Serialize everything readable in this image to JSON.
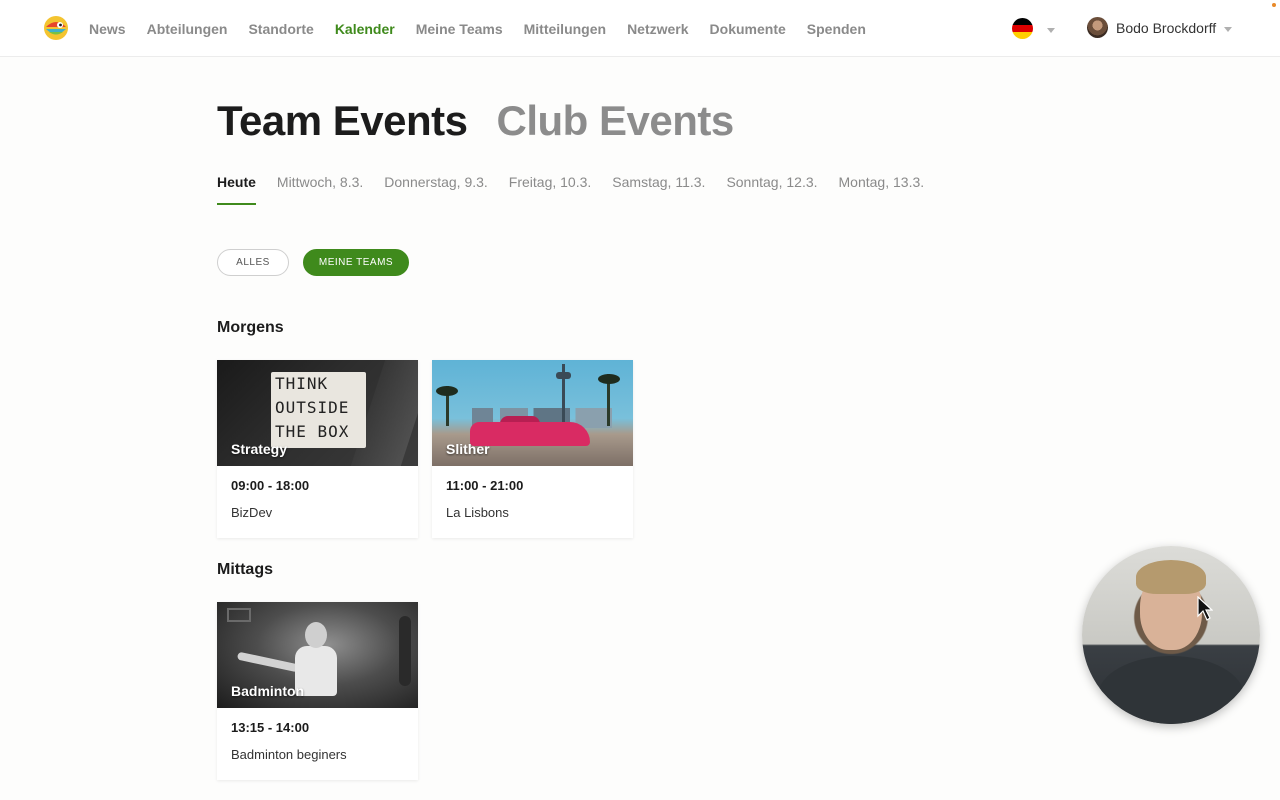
{
  "nav": {
    "items": [
      "News",
      "Abteilungen",
      "Standorte",
      "Kalender",
      "Meine Teams",
      "Mitteilungen",
      "Netzwerk",
      "Dokumente",
      "Spenden"
    ],
    "active": "Kalender"
  },
  "user": {
    "name": "Bodo Brockdorff"
  },
  "language": {
    "flag_colors": [
      "#000000",
      "#dd0000",
      "#ffce00"
    ]
  },
  "headings": {
    "team_events": "Team Events",
    "club_events": "Club Events"
  },
  "days": [
    "Heute",
    "Mittwoch, 8.3.",
    "Donnerstag, 9.3.",
    "Freitag, 10.3.",
    "Samstag, 11.3.",
    "Sonntag, 12.3.",
    "Montag, 13.3."
  ],
  "filters": {
    "all": "ALLES",
    "my_teams": "MEINE TEAMS"
  },
  "sections": {
    "morning": {
      "title": "Morgens",
      "events": [
        {
          "category": "Strategy",
          "time": "09:00 - 18:00",
          "team": "BizDev",
          "image_text": [
            "THINK",
            "OUTSIDE",
            "THE BOX"
          ]
        },
        {
          "category": "Slither",
          "time": "11:00 - 21:00",
          "team": "La Lisbons"
        }
      ]
    },
    "noon": {
      "title": "Mittags",
      "events": [
        {
          "category": "Badminton",
          "time": "13:15 - 14:00",
          "team": "Badminton beginers"
        }
      ]
    }
  },
  "colors": {
    "accent": "#3f8a1c",
    "inactive_text": "#8a8a8a"
  }
}
